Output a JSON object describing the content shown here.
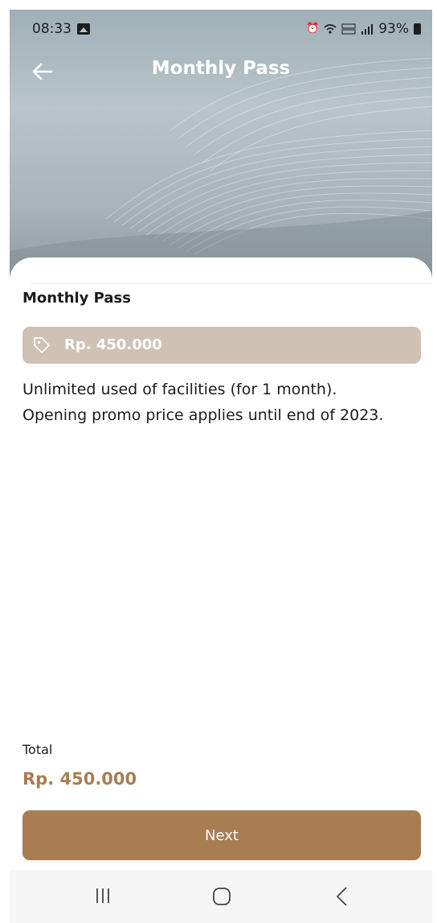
{
  "status_bar": {
    "time": "08:33",
    "battery": "93%",
    "icons": [
      "photo-icon",
      "alarm-icon",
      "wifi-icon",
      "volte-icon",
      "signal-icon",
      "battery-icon"
    ]
  },
  "app_bar": {
    "title": "Monthly Pass",
    "back_icon": "arrow-left-icon"
  },
  "pass": {
    "name": "Monthly Pass",
    "price": "Rp. 450.000",
    "price_icon": "tag-icon",
    "description_line1": "Unlimited used of facilities (for 1 month).",
    "description_line2": "Opening promo price applies until end of 2023."
  },
  "summary": {
    "total_label": "Total",
    "total_value": "Rp. 450.000"
  },
  "actions": {
    "next_label": "Next"
  },
  "colors": {
    "accent": "#a87d52",
    "price_tag_bg": "#cfc1b3",
    "hero_bg": "#b9c5ca"
  },
  "nav_bar": {
    "icons": [
      "recent-apps-icon",
      "home-icon",
      "back-icon"
    ]
  }
}
